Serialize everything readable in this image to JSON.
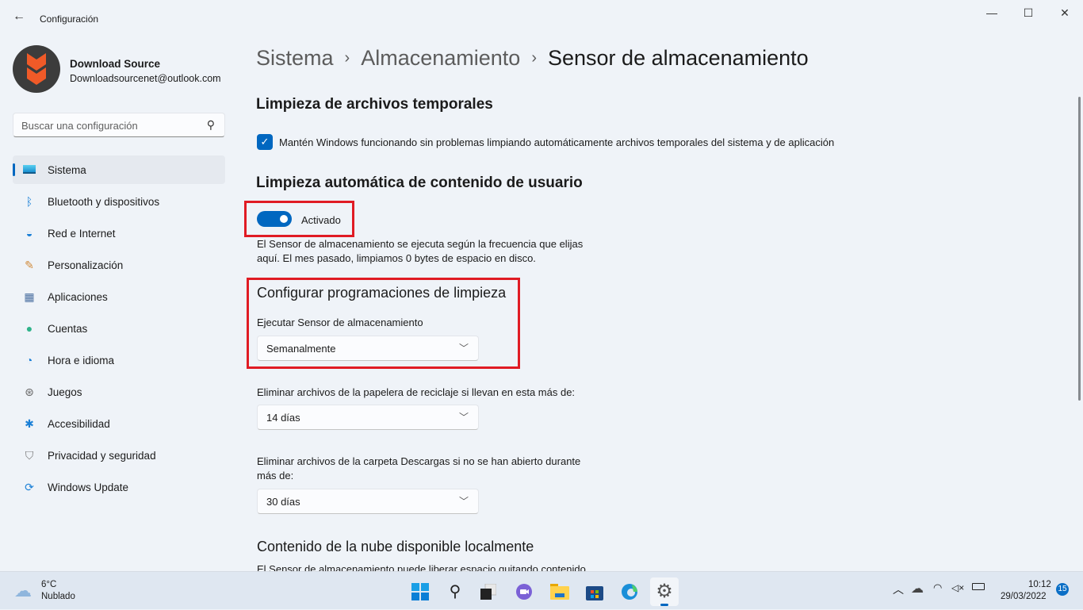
{
  "window": {
    "title": "Configuración",
    "controls": {
      "minimize": "—",
      "maximize": "☐",
      "close": "✕"
    }
  },
  "user": {
    "name": "Download Source",
    "email": "Downloadsourcenet@outlook.com"
  },
  "search": {
    "placeholder": "Buscar una configuración"
  },
  "sidebar": {
    "items": [
      {
        "label": "Sistema",
        "icon": "monitor-icon",
        "active": true
      },
      {
        "label": "Bluetooth y dispositivos",
        "icon": "bluetooth-icon"
      },
      {
        "label": "Red e Internet",
        "icon": "wifi-icon"
      },
      {
        "label": "Personalización",
        "icon": "brush-icon"
      },
      {
        "label": "Aplicaciones",
        "icon": "apps-icon"
      },
      {
        "label": "Cuentas",
        "icon": "person-icon"
      },
      {
        "label": "Hora e idioma",
        "icon": "clock-globe-icon"
      },
      {
        "label": "Juegos",
        "icon": "gamepad-icon"
      },
      {
        "label": "Accesibilidad",
        "icon": "accessibility-icon"
      },
      {
        "label": "Privacidad y seguridad",
        "icon": "shield-icon"
      },
      {
        "label": "Windows Update",
        "icon": "update-icon"
      }
    ]
  },
  "breadcrumb": [
    "Sistema",
    "Almacenamiento",
    "Sensor de almacenamiento"
  ],
  "main": {
    "temp_heading": "Limpieza de archivos temporales",
    "temp_checkbox": "Mantén Windows funcionando sin problemas limpiando automáticamente archivos temporales del sistema y de aplicación",
    "user_heading": "Limpieza automática de contenido de usuario",
    "toggle_label": "Activado",
    "toggle_on": true,
    "desc_line1": "El Sensor de almacenamiento se ejecuta según la frecuencia que elijas",
    "desc_line2": "aquí. El mes pasado, limpiamos 0 bytes de espacio en disco.",
    "schedule_heading": "Configurar programaciones de limpieza",
    "run_label": "Ejecutar Sensor de almacenamiento",
    "run_value": "Semanalmente",
    "recycle_label": "Eliminar archivos de la papelera de reciclaje si llevan en esta más de:",
    "recycle_value": "14 días",
    "downloads_label1": "Eliminar archivos de la carpeta Descargas si no se han abierto durante",
    "downloads_label2": "más de:",
    "downloads_value": "30 días",
    "cloud_heading": "Contenido de la nube disponible localmente",
    "cloud_desc": "El Sensor de almacenamiento puede liberar espacio quitando contenido"
  },
  "taskbar": {
    "weather_temp": "6°C",
    "weather_desc": "Nublado",
    "time": "10:12",
    "date": "29/03/2022",
    "notifications": "15"
  },
  "colors": {
    "accent": "#0067c0",
    "highlight": "#e01b24",
    "logo": "#f05a28"
  }
}
